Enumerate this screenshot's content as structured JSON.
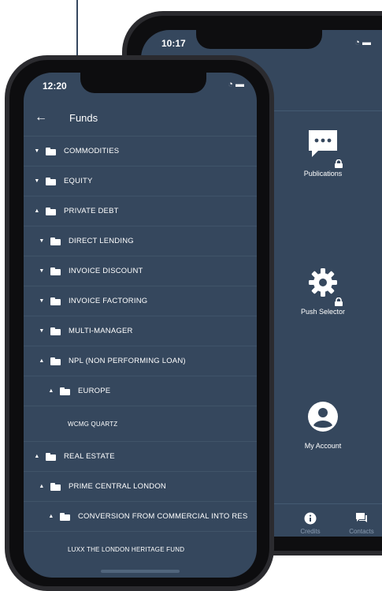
{
  "back_phone": {
    "time": "10:17",
    "tiles": [
      {
        "label": "Publications",
        "icon": "chat-bubble-icon"
      },
      {
        "label": "Push Selector",
        "icon": "gear-icon"
      },
      {
        "label": "My Account",
        "icon": "account-icon"
      }
    ],
    "tabs": [
      {
        "label": "Credits",
        "icon": "info-icon"
      },
      {
        "label": "Contacts",
        "icon": "chat-icon"
      }
    ]
  },
  "front_phone": {
    "time": "12:20",
    "header_title": "Funds",
    "rows": [
      {
        "label": "COMMODITIES",
        "caret": "▼",
        "folder": true
      },
      {
        "label": "EQUITY",
        "caret": "▼",
        "folder": true
      },
      {
        "label": "PRIVATE DEBT",
        "caret": "▲",
        "folder": true
      },
      {
        "label": "DIRECT LENDING",
        "caret": "▼",
        "folder": true
      },
      {
        "label": "INVOICE DISCOUNT",
        "caret": "▼",
        "folder": true
      },
      {
        "label": "INVOICE FACTORING",
        "caret": "▼",
        "folder": true
      },
      {
        "label": "MULTI-MANAGER",
        "caret": "▼",
        "folder": true
      },
      {
        "label": "NPL (NON PERFORMING LOAN)",
        "caret": "▲",
        "folder": true
      },
      {
        "label": "EUROPE",
        "caret": "▲",
        "folder": true
      },
      {
        "label": "WCMG QUARTZ",
        "caret": "",
        "folder": false
      },
      {
        "label": "REAL ESTATE",
        "caret": "▲",
        "folder": true
      },
      {
        "label": "PRIME CENTRAL LONDON",
        "caret": "▲",
        "folder": true
      },
      {
        "label": "CONVERSION FROM COMMERCIAL INTO RES",
        "caret": "▲",
        "folder": true
      },
      {
        "label": "LUXX THE LONDON HERITAGE FUND",
        "caret": "",
        "folder": false
      }
    ]
  },
  "colors": {
    "screen_bg": "#35475d",
    "separator": "#405469",
    "text": "#ffffff"
  }
}
